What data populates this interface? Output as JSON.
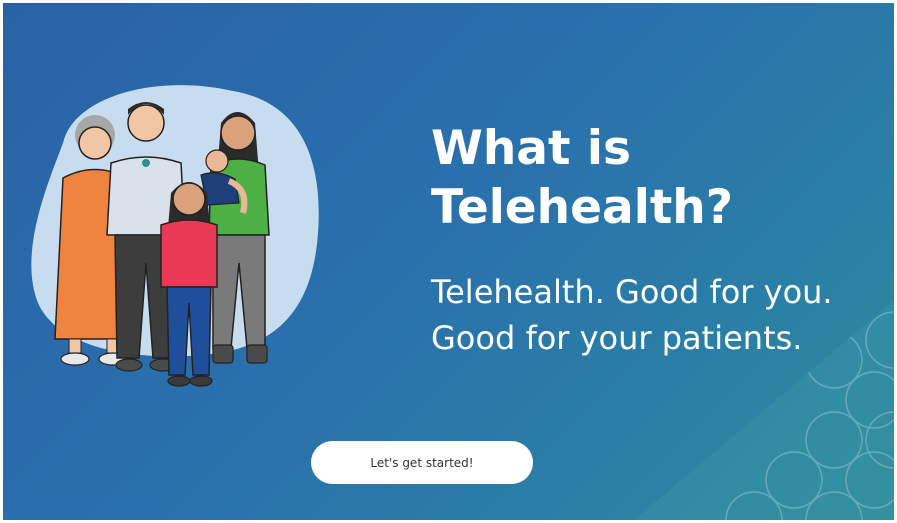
{
  "hero": {
    "title_line1": "What is",
    "title_line2": "Telehealth?",
    "subtitle_line1": "Telehealth. Good for you.",
    "subtitle_line2": "Good for your patients."
  },
  "actions": {
    "start_label": "Let's get started!"
  },
  "colors": {
    "background_start": "#2a62a6",
    "background_end": "#2f8d98",
    "button_bg": "#ffffff",
    "blob": "#c8dcef"
  },
  "illustration": {
    "icon": "family-group-illustration"
  }
}
